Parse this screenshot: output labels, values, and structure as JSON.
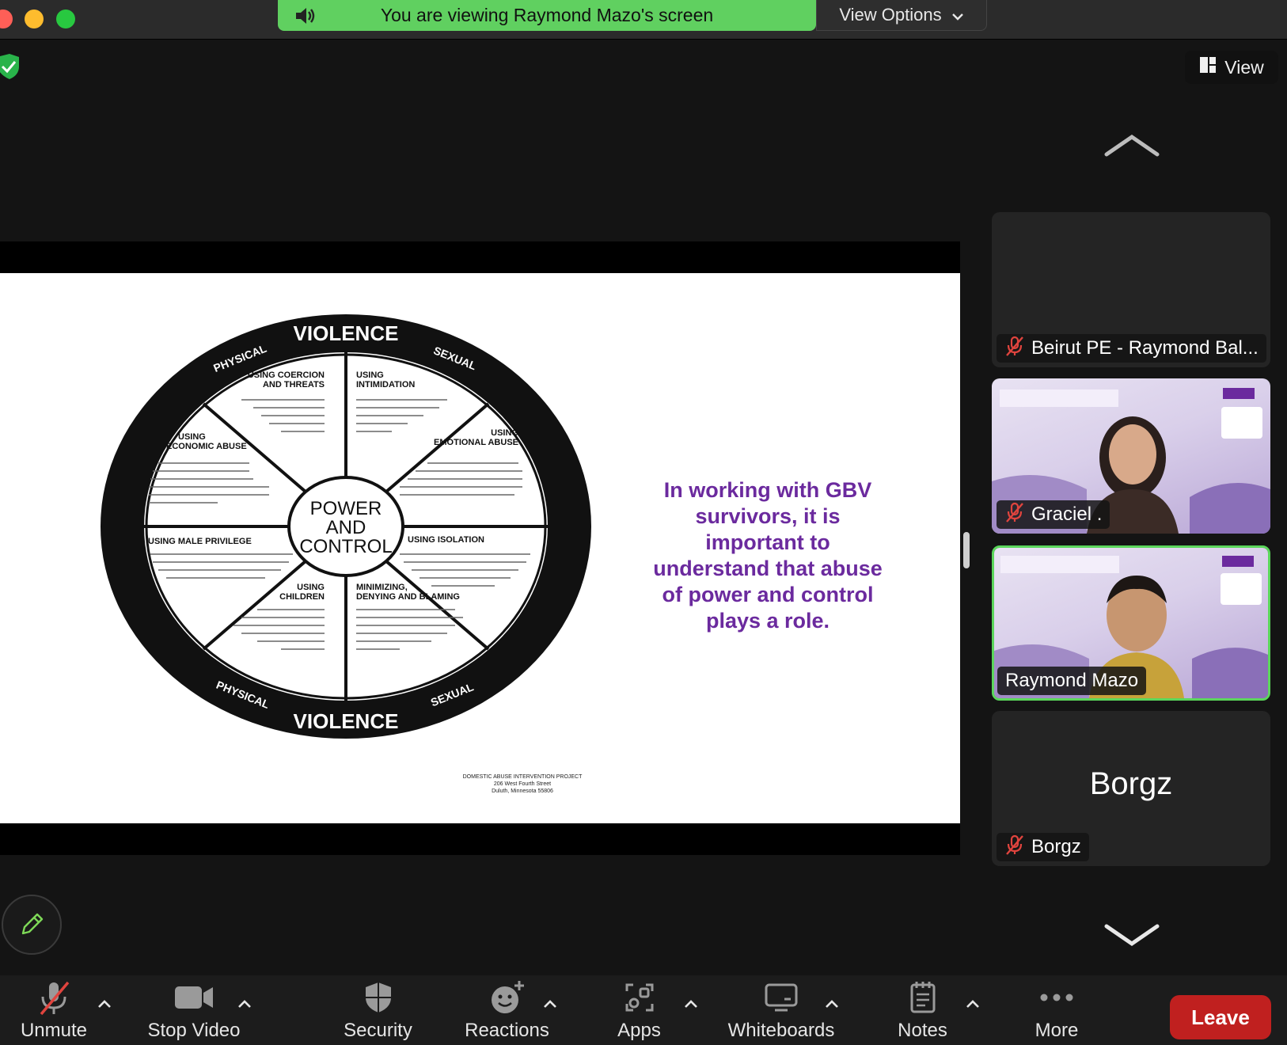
{
  "banner": {
    "viewing_text": "You are viewing Raymond Mazo's screen",
    "view_options_label": "View Options"
  },
  "top": {
    "view_label": "View"
  },
  "slide": {
    "wheel": {
      "top_label": "VIOLENCE",
      "bottom_label": "VIOLENCE",
      "physical_label": "PHYSICAL",
      "sexual_label": "SEXUAL",
      "center_line1": "POWER",
      "center_line2": "AND",
      "center_line3": "CONTROL",
      "sections": [
        {
          "title1": "USING COERCION",
          "title2": "AND THREATS"
        },
        {
          "title1": "USING",
          "title2": "INTIMIDATION"
        },
        {
          "title1": "USING",
          "title2": "EMOTIONAL ABUSE"
        },
        {
          "title1": "USING ISOLATION",
          "title2": ""
        },
        {
          "title1": "MINIMIZING,",
          "title2": "DENYING AND BLAMING"
        },
        {
          "title1": "USING",
          "title2": "CHILDREN"
        },
        {
          "title1": "USING MALE PRIVILEGE",
          "title2": ""
        },
        {
          "title1": "USING",
          "title2": "ECONOMIC ABUSE"
        }
      ]
    },
    "message": "In working with GBV survivors, it is important to understand that abuse of power and control plays a role.",
    "credit_line1": "DOMESTIC ABUSE INTERVENTION PROJECT",
    "credit_line2": "206 West Fourth Street",
    "credit_line3": "Duluth, Minnesota 55806"
  },
  "participants": [
    {
      "name": "Beirut PE - Raymond Bal...",
      "muted": true,
      "video": false
    },
    {
      "name": "Graciel .",
      "muted": true,
      "video": true
    },
    {
      "name": "Raymond Mazo",
      "muted": false,
      "video": true,
      "active": true
    },
    {
      "name": "Borgz",
      "display_name": "Borgz",
      "muted": true,
      "video": false
    }
  ],
  "toolbar": {
    "unmute": "Unmute",
    "stop_video": "Stop Video",
    "security": "Security",
    "reactions": "Reactions",
    "apps": "Apps",
    "whiteboards": "Whiteboards",
    "notes": "Notes",
    "more": "More",
    "leave": "Leave"
  },
  "colors": {
    "banner_green": "#60d060",
    "active_border": "#5bd65b",
    "leave_red": "#c0201f",
    "slide_text_purple": "#6b2a9e",
    "mute_red": "#e0443e"
  }
}
